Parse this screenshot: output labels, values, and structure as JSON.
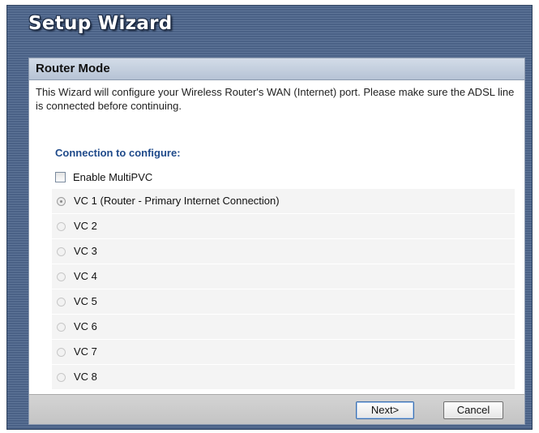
{
  "window": {
    "title": "Setup Wizard"
  },
  "panel": {
    "header": "Router Mode",
    "description": "This Wizard will configure your Wireless Router's WAN (Internet) port. Please make sure the ADSL line is connected before continuing.",
    "section_label": "Connection to configure:",
    "multipvc": {
      "label": "Enable MultiPVC",
      "checked": false
    },
    "vcs": [
      {
        "label": "VC 1 (Router - Primary Internet Connection)",
        "selected": true
      },
      {
        "label": "VC 2",
        "selected": false
      },
      {
        "label": "VC 3",
        "selected": false
      },
      {
        "label": "VC 4",
        "selected": false
      },
      {
        "label": "VC 5",
        "selected": false
      },
      {
        "label": "VC 6",
        "selected": false
      },
      {
        "label": "VC 7",
        "selected": false
      },
      {
        "label": "VC 8",
        "selected": false
      }
    ]
  },
  "buttons": {
    "next": "Next>",
    "cancel": "Cancel"
  }
}
